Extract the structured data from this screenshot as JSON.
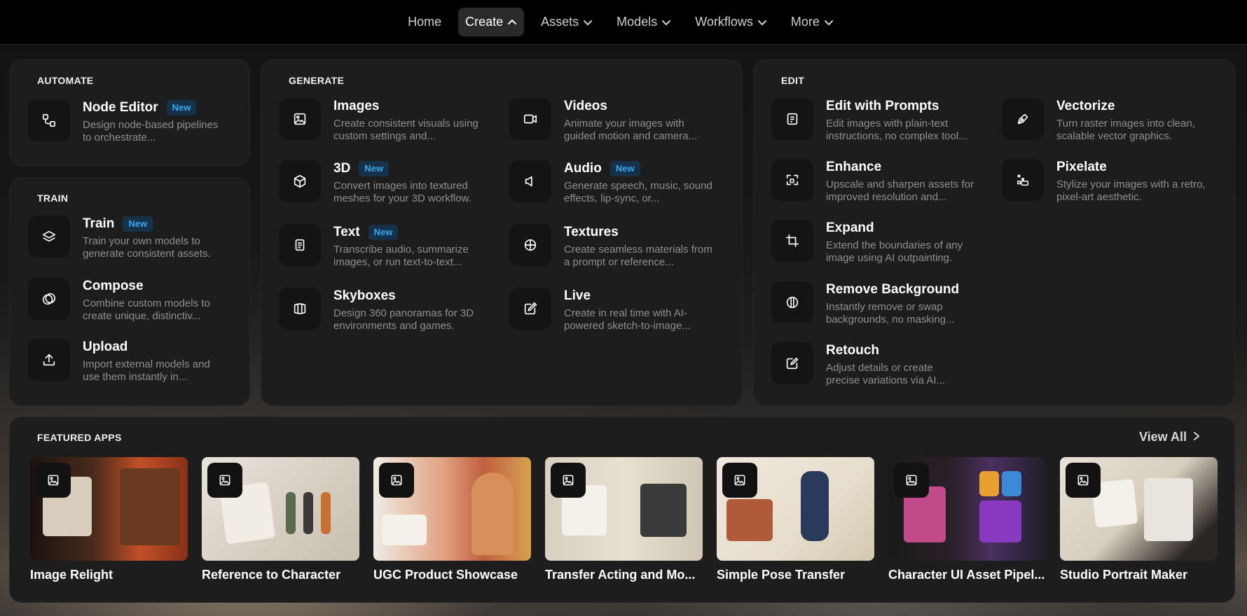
{
  "nav": {
    "items": [
      {
        "label": "Home",
        "has_chevron": false,
        "active": false
      },
      {
        "label": "Create",
        "has_chevron": true,
        "active": true,
        "chevron": "up"
      },
      {
        "label": "Assets",
        "has_chevron": true,
        "active": false,
        "chevron": "down"
      },
      {
        "label": "Models",
        "has_chevron": true,
        "active": false,
        "chevron": "down"
      },
      {
        "label": "Workflows",
        "has_chevron": true,
        "active": false,
        "chevron": "down"
      },
      {
        "label": "More",
        "has_chevron": true,
        "active": false,
        "chevron": "down"
      }
    ]
  },
  "automate": {
    "title": "AUTOMATE",
    "items": [
      {
        "title": "Node Editor",
        "badge": "New",
        "desc": "Design node-based pipelines to orchestrate...",
        "icon": "node-graph-icon"
      }
    ]
  },
  "train": {
    "title": "TRAIN",
    "items": [
      {
        "title": "Train",
        "badge": "New",
        "desc": "Train your own models to generate consistent assets.",
        "icon": "layers-icon"
      },
      {
        "title": "Compose",
        "badge": "",
        "desc": "Combine custom models to create unique, distinctiv...",
        "icon": "overlap-circles-icon"
      },
      {
        "title": "Upload",
        "badge": "",
        "desc": "Import external models and use them instantly in...",
        "icon": "upload-icon"
      }
    ]
  },
  "generate": {
    "title": "GENERATE",
    "items": [
      {
        "title": "Images",
        "badge": "",
        "desc": "Create consistent visuals using custom settings and...",
        "icon": "image-icon"
      },
      {
        "title": "Videos",
        "badge": "",
        "desc": "Animate your images with guided motion and camera...",
        "icon": "video-camera-icon"
      },
      {
        "title": "3D",
        "badge": "New",
        "desc": "Convert images into textured meshes for your 3D workflow.",
        "icon": "cube-icon"
      },
      {
        "title": "Audio",
        "badge": "New",
        "desc": "Generate speech, music, sound effects, lip-sync, or...",
        "icon": "speaker-icon"
      },
      {
        "title": "Text",
        "badge": "New",
        "desc": "Transcribe audio, summarize images, or run text-to-text...",
        "icon": "document-icon"
      },
      {
        "title": "Textures",
        "badge": "",
        "desc": "Create seamless materials from a prompt or reference...",
        "icon": "sphere-grid-icon"
      },
      {
        "title": "Skyboxes",
        "badge": "",
        "desc": "Design 360 panoramas for 3D environments and games.",
        "icon": "skybox-icon"
      },
      {
        "title": "Live",
        "badge": "",
        "desc": "Create in real time with AI-powered sketch-to-image...",
        "icon": "live-edit-icon"
      }
    ]
  },
  "edit": {
    "title": "EDIT",
    "items": [
      {
        "title": "Edit with Prompts",
        "badge": "",
        "desc": "Edit images with plain-text instructions, no complex tool...",
        "icon": "prompt-doc-icon"
      },
      {
        "title": "Vectorize",
        "badge": "",
        "desc": "Turn raster images into clean, scalable vector graphics.",
        "icon": "pen-nib-icon"
      },
      {
        "title": "Enhance",
        "badge": "",
        "desc": "Upscale and sharpen assets for improved resolution and...",
        "icon": "enhance-frame-icon"
      },
      {
        "title": "Pixelate",
        "badge": "",
        "desc": "Stylize your images with a retro, pixel-art aesthetic.",
        "icon": "pixel-image-icon"
      },
      {
        "title": "Expand",
        "badge": "",
        "desc": "Extend the boundaries of any image using AI outpainting.",
        "icon": "crop-expand-icon"
      },
      {
        "title": "Remove Background",
        "badge": "",
        "desc": "Instantly remove or swap backgrounds, no masking...",
        "icon": "segmented-circle-icon"
      },
      {
        "title": "Retouch",
        "badge": "",
        "desc": "Adjust details or create precise variations via AI...",
        "icon": "pencil-square-icon"
      }
    ]
  },
  "featured": {
    "title": "FEATURED APPS",
    "view_all": "View All",
    "apps": [
      {
        "title": "Image Relight"
      },
      {
        "title": "Reference to Character"
      },
      {
        "title": "UGC Product Showcase"
      },
      {
        "title": "Transfer Acting and Mo..."
      },
      {
        "title": "Simple Pose Transfer"
      },
      {
        "title": "Character UI Asset Pipel..."
      },
      {
        "title": "Studio Portrait Maker"
      }
    ]
  }
}
